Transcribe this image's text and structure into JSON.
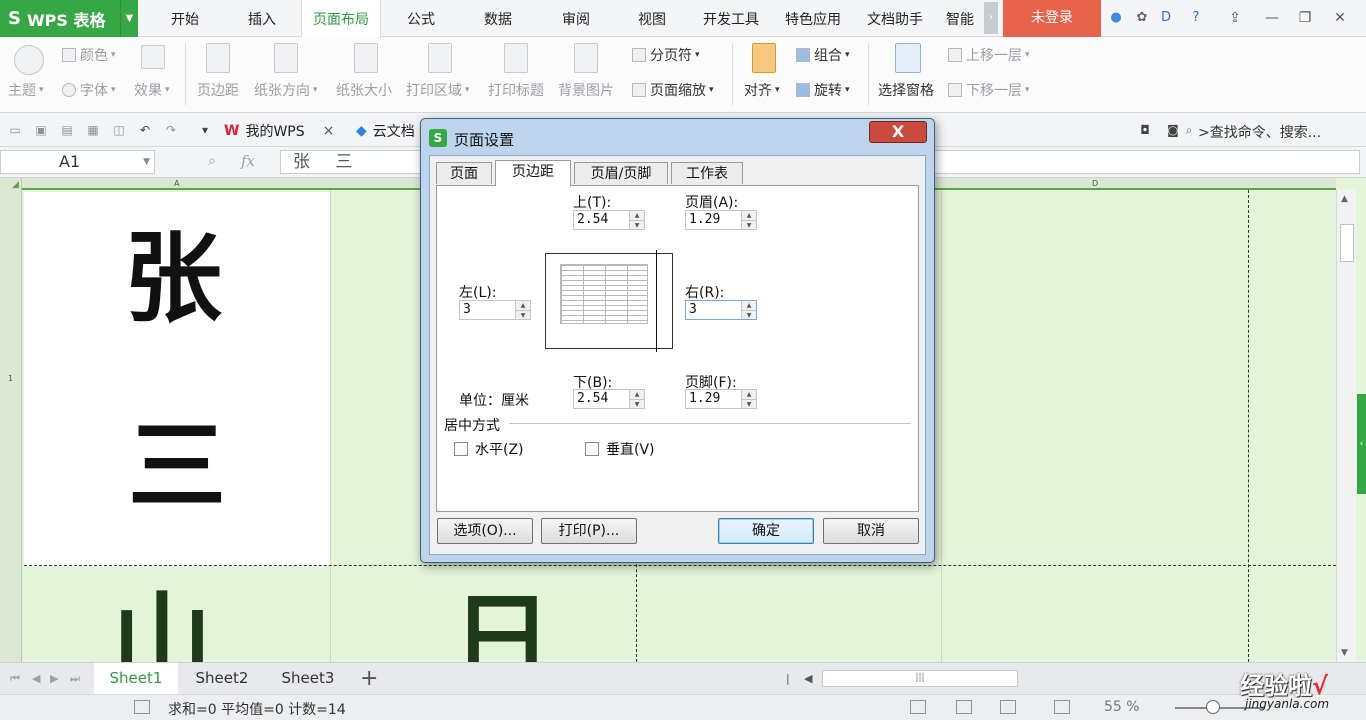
{
  "app": {
    "logo": "S",
    "name": "WPS 表格"
  },
  "menu_tabs": [
    {
      "label": "开始"
    },
    {
      "label": "插入"
    },
    {
      "label": "页面布局",
      "active": true
    },
    {
      "label": "公式"
    },
    {
      "label": "数据"
    },
    {
      "label": "审阅"
    },
    {
      "label": "视图"
    },
    {
      "label": "开发工具"
    },
    {
      "label": "特色应用"
    },
    {
      "label": "文档助手"
    },
    {
      "label": "智能"
    }
  ],
  "login_label": "未登录",
  "ribbon": {
    "color": "颜色",
    "font": "字体",
    "effect": "效果",
    "theme": "主题",
    "margins": "页边距",
    "orientation": "纸张方向",
    "size": "纸张大小",
    "print_area": "打印区域",
    "print_titles": "打印标题",
    "background": "背景图片",
    "page_break": "分页符",
    "page_zoom": "页面缩放",
    "align": "对齐",
    "group": "组合",
    "rotate": "旋转",
    "selection_pane": "选择窗格",
    "bring_forward": "上移一层",
    "send_backward": "下移一层"
  },
  "quickbar": {
    "my_wps": "我的WPS",
    "cloud_docs": "云文档",
    "search": ">查找命令、搜索..."
  },
  "formula": {
    "cell_ref": "A1",
    "fx": "fx",
    "content": "张 三"
  },
  "columns": [
    "A",
    "D"
  ],
  "row_label": "1",
  "sheet_chars": [
    "张",
    "三"
  ],
  "sheet_tabs": [
    {
      "label": "Sheet1",
      "active": true
    },
    {
      "label": "Sheet2"
    },
    {
      "label": "Sheet3"
    }
  ],
  "status": {
    "summary": "求和=0  平均值=0  计数=14",
    "zoom": "55 %"
  },
  "watermark": {
    "text": "经验啦",
    "check": "√",
    "url": "jingyanla.com"
  },
  "dialog": {
    "title": "页面设置",
    "close": "X",
    "tabs": [
      {
        "label": "页面"
      },
      {
        "label": "页边距",
        "active": true
      },
      {
        "label": "页眉/页脚"
      },
      {
        "label": "工作表"
      }
    ],
    "fields": {
      "top": {
        "label": "上(T):",
        "value": "2.54"
      },
      "header": {
        "label": "页眉(A):",
        "value": "1.29"
      },
      "left": {
        "label": "左(L):",
        "value": "3"
      },
      "right": {
        "label": "右(R):",
        "value": "3"
      },
      "bottom": {
        "label": "下(B):",
        "value": "2.54"
      },
      "footer": {
        "label": "页脚(F):",
        "value": "1.29"
      }
    },
    "unit": "单位：厘米",
    "center_title": "居中方式",
    "horizontal": "水平(Z)",
    "vertical": "垂直(V)",
    "buttons": {
      "options": "选项(O)...",
      "print": "打印(P)...",
      "ok": "确定",
      "cancel": "取消"
    }
  }
}
